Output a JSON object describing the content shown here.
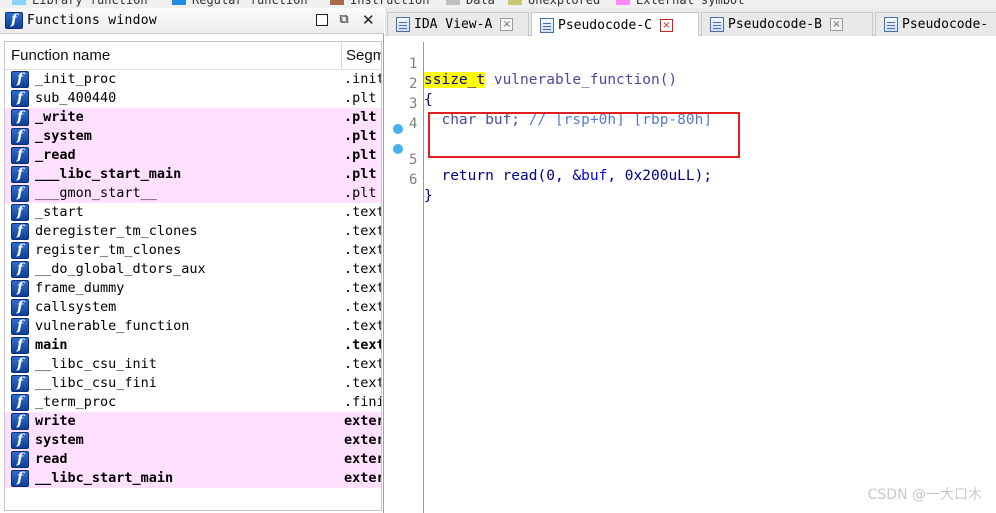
{
  "legend": [
    {
      "label": "Library function",
      "color": "#8ad3ff"
    },
    {
      "label": "Regular function",
      "color": "#1f8fe6"
    },
    {
      "label": "Instruction",
      "color": "#a86a4a"
    },
    {
      "label": "Data",
      "color": "#bfbfbf"
    },
    {
      "label": "Unexplored",
      "color": "#c8c870"
    },
    {
      "label": "External symbol",
      "color": "#ff88ff"
    }
  ],
  "functions_window": {
    "title": "Functions window",
    "col_name": "Function name",
    "col_segment": "Segm",
    "icon_glyph": "f",
    "rows": [
      {
        "name": "_init_proc",
        "seg": ".init",
        "lib": false,
        "bold": false
      },
      {
        "name": "sub_400440",
        "seg": ".plt",
        "lib": false,
        "bold": false
      },
      {
        "name": "_write",
        "seg": ".plt",
        "lib": true,
        "bold": true
      },
      {
        "name": "_system",
        "seg": ".plt",
        "lib": true,
        "bold": true
      },
      {
        "name": "_read",
        "seg": ".plt",
        "lib": true,
        "bold": true
      },
      {
        "name": "___libc_start_main",
        "seg": ".plt",
        "lib": true,
        "bold": true
      },
      {
        "name": "___gmon_start__",
        "seg": ".plt",
        "lib": true,
        "bold": false
      },
      {
        "name": "_start",
        "seg": ".text",
        "lib": false,
        "bold": false
      },
      {
        "name": "deregister_tm_clones",
        "seg": ".text",
        "lib": false,
        "bold": false
      },
      {
        "name": "register_tm_clones",
        "seg": ".text",
        "lib": false,
        "bold": false
      },
      {
        "name": "__do_global_dtors_aux",
        "seg": ".text",
        "lib": false,
        "bold": false
      },
      {
        "name": "frame_dummy",
        "seg": ".text",
        "lib": false,
        "bold": false
      },
      {
        "name": "callsystem",
        "seg": ".text",
        "lib": false,
        "bold": false
      },
      {
        "name": "vulnerable_function",
        "seg": ".text",
        "lib": false,
        "bold": false
      },
      {
        "name": "main",
        "seg": ".text",
        "lib": false,
        "bold": true
      },
      {
        "name": "__libc_csu_init",
        "seg": ".text",
        "lib": false,
        "bold": false
      },
      {
        "name": "__libc_csu_fini",
        "seg": ".text",
        "lib": false,
        "bold": false
      },
      {
        "name": "_term_proc",
        "seg": ".fini",
        "lib": false,
        "bold": false
      },
      {
        "name": "write",
        "seg": "extern",
        "lib": true,
        "bold": true
      },
      {
        "name": "system",
        "seg": "extern",
        "lib": true,
        "bold": true
      },
      {
        "name": "read",
        "seg": "extern",
        "lib": true,
        "bold": true
      },
      {
        "name": "__libc_start_main",
        "seg": "extern",
        "lib": true,
        "bold": true
      }
    ]
  },
  "tabs": [
    {
      "label": "IDA View-A",
      "active": false,
      "close": "×"
    },
    {
      "label": "Pseudocode-C",
      "active": true,
      "close": "×"
    },
    {
      "label": "Pseudocode-B",
      "active": false,
      "close": "×"
    },
    {
      "label": "Pseudocode-",
      "active": false,
      "close": ""
    }
  ],
  "code": {
    "lines": [
      "1",
      "2",
      "3",
      "4",
      "5",
      "6"
    ],
    "ret_type": "ssize_t",
    "signature": " vulnerable_function()",
    "open_brace": "{",
    "decl": "  char buf; ",
    "comment": "// [rsp+0h] [rbp-80h]",
    "stmt_kw": "  return read(0, &",
    "stmt_var": "buf",
    "stmt_rest": ", 0x200uLL);",
    "close_brace": "}"
  },
  "watermark": "CSDN @一大口木"
}
